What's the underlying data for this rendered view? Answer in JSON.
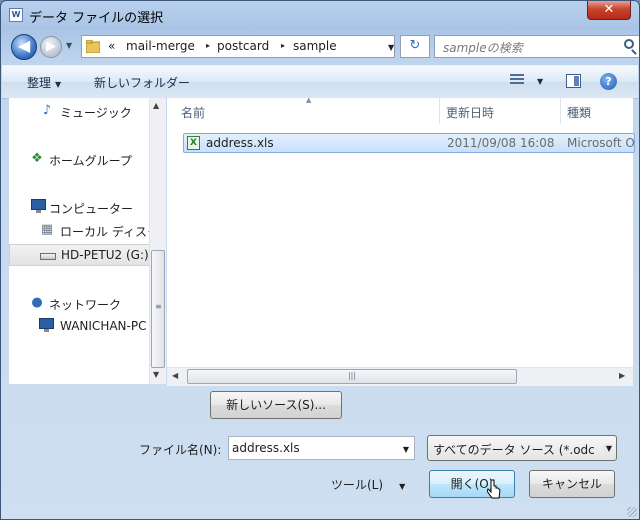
{
  "window": {
    "title": "データ ファイルの選択",
    "app_icon_text": "W"
  },
  "title_bar": {
    "close_label": "✕"
  },
  "navigation": {
    "back_glyph": "◀",
    "forward_glyph": "▶",
    "breadcrumb": {
      "overflow": "«",
      "items": [
        "mail-merge",
        "postcard",
        "sample"
      ],
      "separator": "▸"
    },
    "refresh_glyph": "↻",
    "search_placeholder": "sampleの検索"
  },
  "toolbar": {
    "organize": "整理",
    "new_folder": "新しいフォルダー"
  },
  "nav_pane": {
    "items": [
      {
        "label": "ミュージック",
        "icon": "music-icon"
      },
      {
        "label": "ホームグループ",
        "icon": "homegroup-icon"
      },
      {
        "label": "コンピューター",
        "icon": "computer-icon"
      },
      {
        "label": "ローカル ディスク",
        "icon": "local-disk-icon"
      },
      {
        "label": "HD-PETU2 (G:)",
        "icon": "drive-icon",
        "selected": true
      },
      {
        "label": "ネットワーク",
        "icon": "network-icon"
      },
      {
        "label": "WANICHAN-PC",
        "icon": "pc-icon"
      }
    ]
  },
  "file_list": {
    "columns": [
      "名前",
      "更新日時",
      "種類"
    ],
    "rows": [
      {
        "name": "address.xls",
        "modified": "2011/09/08 16:08",
        "type": "Microsoft O",
        "selected": true
      }
    ]
  },
  "new_source_button": "新しいソース(S)...",
  "file_name": {
    "label": "ファイル名(N):",
    "value": "address.xls"
  },
  "file_type": {
    "value": "すべてのデータ ソース (*.odc"
  },
  "tools": {
    "label": "ツール(L)"
  },
  "open_button": "開く(O)",
  "cancel_button": "キャンセル",
  "colors": {
    "accent": "#3c7fb1",
    "selection": "#c7e0fb",
    "close": "#c7432c"
  }
}
